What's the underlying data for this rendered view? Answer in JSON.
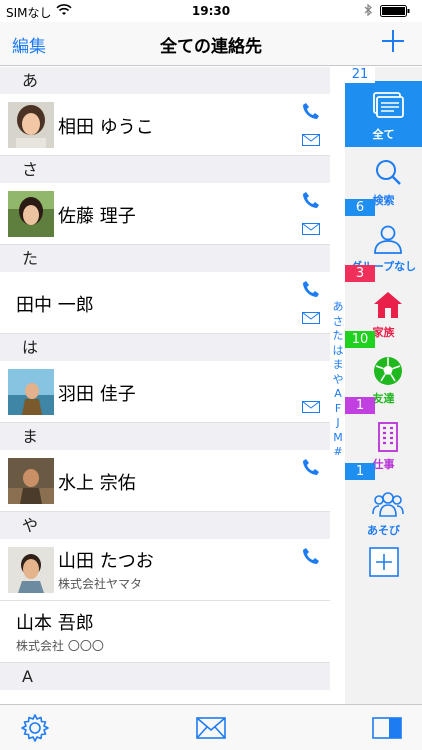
{
  "status": {
    "carrier": "SIMなし",
    "time": "19:30"
  },
  "nav": {
    "edit": "編集",
    "title": "全ての連絡先"
  },
  "list": {
    "sections": [
      {
        "header": "あ",
        "contacts": [
          {
            "name": "相田 ゆうこ",
            "company": "",
            "phone": true,
            "mail": true,
            "photo": true
          }
        ]
      },
      {
        "header": "さ",
        "contacts": [
          {
            "name": "佐藤 理子",
            "company": "",
            "phone": true,
            "mail": true,
            "photo": true
          }
        ]
      },
      {
        "header": "た",
        "contacts": [
          {
            "name": "田中 一郎",
            "company": "",
            "phone": true,
            "mail": true,
            "photo": false
          }
        ]
      },
      {
        "header": "は",
        "contacts": [
          {
            "name": "羽田 佳子",
            "company": "",
            "phone": false,
            "mail": true,
            "photo": true
          }
        ]
      },
      {
        "header": "ま",
        "contacts": [
          {
            "name": "水上 宗佑",
            "company": "",
            "phone": true,
            "mail": false,
            "photo": true
          }
        ]
      },
      {
        "header": "や",
        "contacts": [
          {
            "name": "山田 たつお",
            "company": "株式会社ヤマタ",
            "phone": true,
            "mail": false,
            "photo": true
          },
          {
            "name": "山本 吾郎",
            "company": "株式会社 〇〇〇",
            "phone": false,
            "mail": false,
            "photo": false
          }
        ]
      },
      {
        "header": "A",
        "contacts": []
      }
    ]
  },
  "index": [
    "あ",
    "さ",
    "た",
    "は",
    "ま",
    "や",
    "A",
    "F",
    "J",
    "M",
    "#"
  ],
  "sidebar": {
    "groups": [
      {
        "label": "全て",
        "count": "21",
        "icon": "all-cards-icon",
        "badge_color": "#1e8ff0"
      },
      {
        "label": "検索",
        "count": "",
        "icon": "search-icon",
        "badge_color": ""
      },
      {
        "label": "グループなし",
        "count": "6",
        "icon": "person-icon",
        "badge_color": "#1e8ff0"
      },
      {
        "label": "家族",
        "count": "3",
        "icon": "home-icon",
        "badge_color": "#f0305a"
      },
      {
        "label": "友達",
        "count": "10",
        "icon": "soccer-ball-icon",
        "badge_color": "#1fd21f"
      },
      {
        "label": "仕事",
        "count": "1",
        "icon": "building-icon",
        "badge_color": "#c040e0"
      },
      {
        "label": "あそび",
        "count": "1",
        "icon": "people-icon",
        "badge_color": "#1e8ff0"
      }
    ]
  },
  "colors": {
    "accent": "#1e7cf2",
    "family": "#e8204a",
    "friends": "#1fb81f",
    "work": "#b830d8"
  }
}
